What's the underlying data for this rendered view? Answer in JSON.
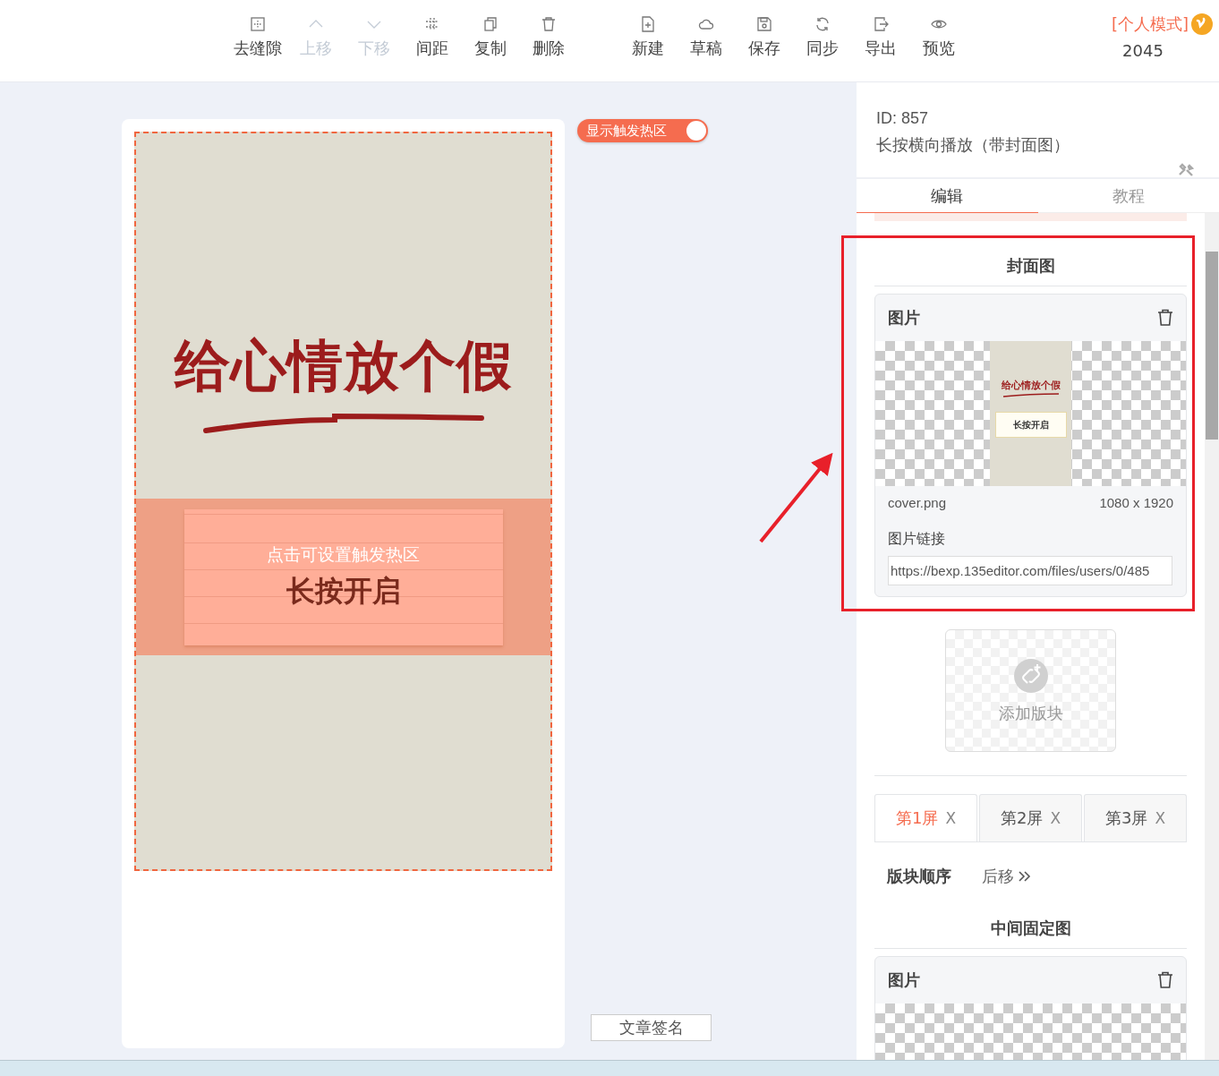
{
  "toolbar": {
    "groups": [
      {
        "items": [
          {
            "kind": "gap",
            "label": "去缝隙",
            "disabled": false
          },
          {
            "kind": "up",
            "label": "上移",
            "disabled": true
          },
          {
            "kind": "down",
            "label": "下移",
            "disabled": true
          },
          {
            "kind": "spacing",
            "label": "间距",
            "disabled": false
          },
          {
            "kind": "copy",
            "label": "复制",
            "disabled": false
          },
          {
            "kind": "delete",
            "label": "删除",
            "disabled": false
          }
        ]
      },
      {
        "items": [
          {
            "kind": "new",
            "label": "新建",
            "disabled": false
          },
          {
            "kind": "draft",
            "label": "草稿",
            "disabled": false
          },
          {
            "kind": "save",
            "label": "保存",
            "disabled": false
          },
          {
            "kind": "sync",
            "label": "同步",
            "disabled": false
          },
          {
            "kind": "export",
            "label": "导出",
            "disabled": false
          },
          {
            "kind": "preview",
            "label": "预览",
            "disabled": false
          }
        ]
      }
    ]
  },
  "account": {
    "mode": "[个人模式]",
    "count": "2045"
  },
  "canvas": {
    "title": "给心情放个假",
    "button_text": "长按开启",
    "hotzone_hint": "点击可设置触发热区",
    "hotzone_toggle": {
      "label": "显示触发热区",
      "on": true
    },
    "signature_button": "文章签名"
  },
  "panel": {
    "id": "ID: 857",
    "name": "长按横向播放（带封面图）",
    "tabs": [
      {
        "label": "编辑",
        "selected": true
      },
      {
        "label": "教程",
        "selected": false
      }
    ],
    "cover": {
      "heading": "封面图",
      "card_title": "图片",
      "thumb_title": "给心情放个假",
      "thumb_button": "长按开启",
      "filename": "cover.png",
      "dimensions": "1080 x 1920",
      "link_label": "图片链接",
      "link_value": "https://bexp.135editor.com/files/users/0/485"
    },
    "add_block": "添加版块",
    "screen_tabs": [
      {
        "label": "第1屏",
        "close": "X",
        "selected": true
      },
      {
        "label": "第2屏",
        "close": "X",
        "selected": false
      },
      {
        "label": "第3屏",
        "close": "X",
        "selected": false
      }
    ],
    "order": {
      "label": "版块顺序",
      "action": "后移"
    },
    "middle": {
      "heading": "中间固定图",
      "card_title": "图片"
    }
  }
}
